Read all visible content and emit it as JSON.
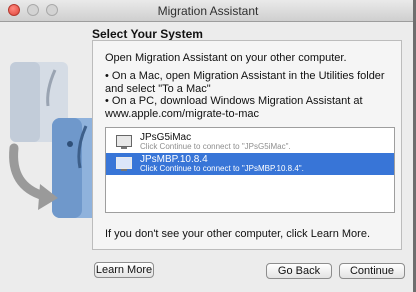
{
  "window": {
    "title": "Migration Assistant"
  },
  "heading": "Select Your System",
  "panel": {
    "intro": "Open Migration Assistant on your other computer.",
    "bullets": [
      "• On a Mac, open Migration Assistant in the Utilities folder",
      "and select \"To a Mac\"",
      "• On a PC, download Windows Migration Assistant at",
      "www.apple.com/migrate-to-mac"
    ],
    "computers": [
      {
        "name": "JPsG5iMac",
        "hint": "Click Continue to connect to \"JPsG5iMac\".",
        "selected": false,
        "icon": "imac-icon"
      },
      {
        "name": "JPsMBP.10.8.4",
        "hint": "Click Continue to connect to \"JPsMBP.10.8.4\".",
        "selected": true,
        "icon": "laptop-icon"
      }
    ],
    "footer": "If you don't see your other computer, click Learn More."
  },
  "buttons": {
    "learn_more": "Learn More",
    "go_back": "Go Back",
    "continue": "Continue"
  },
  "colors": {
    "selection": "#3875d7",
    "close_button": "#e0443a"
  }
}
